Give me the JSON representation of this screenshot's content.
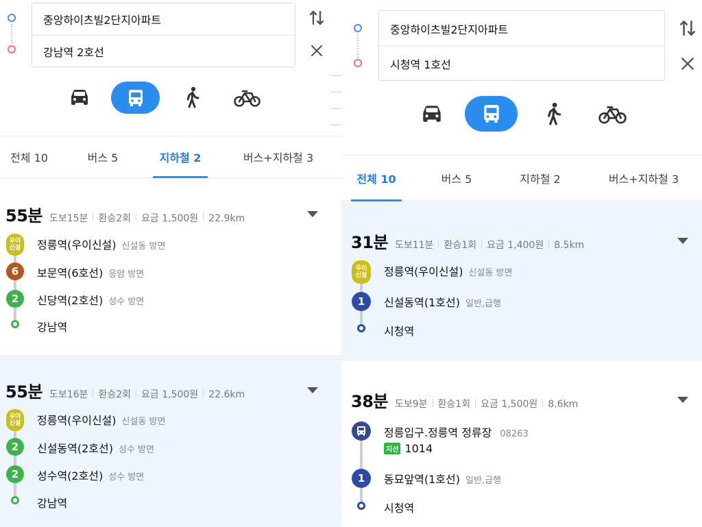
{
  "left": {
    "search": {
      "origin": "중앙하이츠빌2단지아파트",
      "destination": "강남역 2호선"
    },
    "tabs": [
      {
        "label": "전체 10",
        "active": false
      },
      {
        "label": "버스 5",
        "active": false
      },
      {
        "label": "지하철 2",
        "active": true
      },
      {
        "label": "버스+지하철 3",
        "active": false
      }
    ],
    "routes": [
      {
        "duration": "55분",
        "walk": "도보15분",
        "transfer": "환승2회",
        "fare": "요금 1,500원",
        "distance": "22.9km",
        "stops": [
          {
            "badge": "우이\n신설",
            "name": "정릉역(우이신설)",
            "dir": "신설동 방면"
          },
          {
            "badge": "6",
            "name": "보문역(6호선)",
            "dir": "응암 방면"
          },
          {
            "badge": "2",
            "name": "신당역(2호선)",
            "dir": "성수 방면"
          },
          {
            "badge": "",
            "name": "강남역",
            "dir": ""
          }
        ]
      },
      {
        "duration": "55분",
        "walk": "도보16분",
        "transfer": "환승2회",
        "fare": "요금 1,500원",
        "distance": "22.6km",
        "stops": [
          {
            "badge": "우이\n신설",
            "name": "정릉역(우이신설)",
            "dir": "신설동 방면"
          },
          {
            "badge": "2",
            "name": "신설동역(2호선)",
            "dir": "성수 방면"
          },
          {
            "badge": "2",
            "name": "성수역(2호선)",
            "dir": "성수 방면"
          },
          {
            "badge": "",
            "name": "강남역",
            "dir": ""
          }
        ]
      }
    ]
  },
  "right": {
    "search": {
      "origin": "중앙하이츠빌2단지아파트",
      "destination": "시청역 1호선"
    },
    "tabs": [
      {
        "label": "전체 10",
        "active": true
      },
      {
        "label": "버스 5",
        "active": false
      },
      {
        "label": "지하철 2",
        "active": false
      },
      {
        "label": "버스+지하철 3",
        "active": false
      }
    ],
    "routes": [
      {
        "duration": "31분",
        "walk": "도보11분",
        "transfer": "환승1회",
        "fare": "요금 1,400원",
        "distance": "8.5km",
        "stops": [
          {
            "badge": "우이\n신설",
            "name": "정릉역(우이신설)",
            "dir": "신설동 방면"
          },
          {
            "badge": "1",
            "name": "신설동역(1호선)",
            "dir": "일반,급행"
          },
          {
            "badge": "",
            "name": "시청역",
            "dir": ""
          }
        ]
      },
      {
        "duration": "38분",
        "walk": "도보9분",
        "transfer": "환승1회",
        "fare": "요금 1,500원",
        "distance": "8.6km",
        "stops": [
          {
            "badge": "bus",
            "name": "정릉입구.정릉역 정류장",
            "dir": "08263",
            "bus_tag": "지선",
            "bus_no": "1014"
          },
          {
            "badge": "1",
            "name": "동묘앞역(1호선)",
            "dir": "일반,급행"
          },
          {
            "badge": "",
            "name": "시청역",
            "dir": ""
          }
        ]
      }
    ]
  },
  "colors": {
    "accent": "#2b8def",
    "line_ui": "#cbbf1a",
    "line_6": "#b5561a",
    "line_2": "#3cb44b",
    "line_1": "#2c4aa8",
    "bus": "#344a8f",
    "origin_pin": "#4a90e2",
    "dest_pin": "#ff6b6b"
  },
  "icons": {
    "modes": [
      "car-icon",
      "bus-icon",
      "walk-icon",
      "bicycle-icon"
    ],
    "swap": "swap-arrows-icon",
    "close": "close-icon",
    "expand": "chevron-down-icon"
  }
}
